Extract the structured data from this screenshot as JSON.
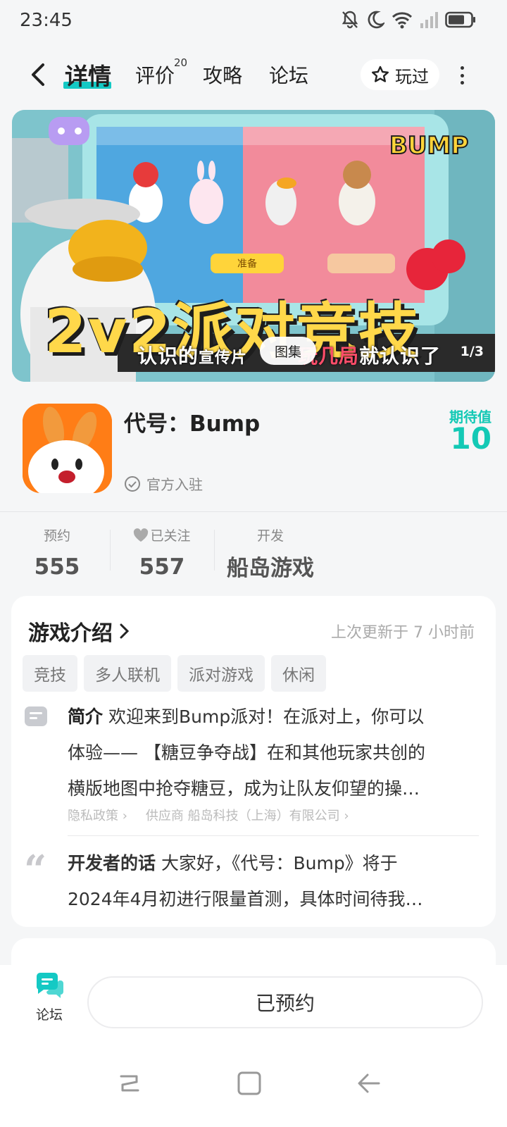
{
  "status": {
    "time": "23:45",
    "icons": [
      "mute-icon",
      "moon-icon",
      "wifi-icon",
      "signal-icon",
      "battery-icon"
    ]
  },
  "nav": {
    "tabs": [
      {
        "label": "详情",
        "active": true
      },
      {
        "label": "评价",
        "badge": "20"
      },
      {
        "label": "攻略"
      },
      {
        "label": "论坛"
      }
    ],
    "played_label": "玩过",
    "accent": "#14c9c4"
  },
  "banner": {
    "title": "2v2派对竞技",
    "overlay_text_white_1": "认识的",
    "overlay_text_mid": "宣传片",
    "overlay_text_red": "玩几局",
    "overlay_text_white_2": "就认识了",
    "gallery_label": "图集",
    "page_indicator": "1/3",
    "logo_text": "BUMP",
    "button_text": "准备"
  },
  "game": {
    "name": "代号：Bump",
    "official_label": "官方入驻",
    "expect_label": "期待值",
    "expect_value": "10"
  },
  "stats": [
    {
      "label": "预约",
      "value": "555"
    },
    {
      "label": "已关注",
      "value": "557",
      "icon": "heart-icon"
    },
    {
      "label": "开发",
      "value": "船岛游戏"
    }
  ],
  "intro": {
    "title": "游戏介绍",
    "updated": "上次更新于 7 小时前",
    "tags": [
      "竞技",
      "多人联机",
      "派对游戏",
      "休闲"
    ],
    "summary_label": "简介",
    "summary_line1": "欢迎来到Bump派对！在派对上，你可以",
    "summary_line2": "体验—— 【糖豆争夺战】在和其他玩家共创的",
    "summary_line3": "横版地图中抢夺糖豆，成为让队友仰望的操…",
    "privacy_link": "隐私政策",
    "supplier_link": "供应商 船岛科技（上海）有限公司",
    "dev_label": "开发者的话",
    "dev_line1": "大家好，《代号：Bump》将于",
    "dev_line2": "2024年4月初进行限量首测，具体时间待我…"
  },
  "bottom": {
    "forum_label": "论坛",
    "reserved_label": "已预约"
  }
}
